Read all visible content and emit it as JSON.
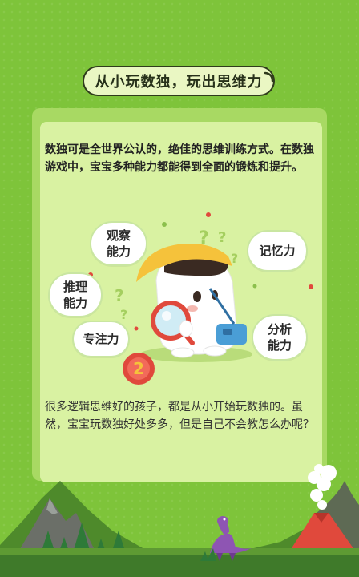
{
  "title": "从小玩数独，玩出思维力",
  "intro": "数独可是全世界公认的，绝佳的思维训练方式。在数独游戏中，宝宝多种能力都能得到全面的锻炼和提升。",
  "abilities": {
    "observe": "观察\n能力",
    "memory": "记忆力",
    "reasoning": "推理\n能力",
    "analysis": "分析\n能力",
    "focus": "专注力"
  },
  "badge_number": "2",
  "outro": "很多逻辑思维好的孩子，都是从小开始玩数独的。虽然，宝宝玩数独好处多多，但是自己不会教怎么办呢？",
  "colors": {
    "background": "#7ec43a",
    "card": "#d9f2a2",
    "accent_yellow": "#f5c23b",
    "accent_red": "#e0493c"
  }
}
